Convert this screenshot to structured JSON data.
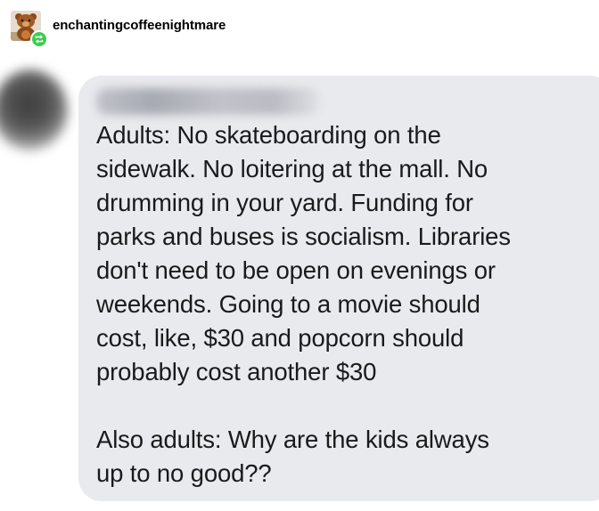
{
  "post": {
    "username": "enchantingcoffeenightmare",
    "avatar_icon": "bear-figure-avatar",
    "badge_icon": "reblog-icon",
    "badge_color": "#3ecc50"
  },
  "message": {
    "sender_name_blurred": true,
    "lines": [
      "Adults: No skateboarding on the",
      "sidewalk. No loitering at the mall. No",
      "drumming in your yard. Funding for",
      "parks and buses is socialism. Libraries",
      "don't need to be open on evenings or",
      "weekends. Going to a movie should",
      "cost, like, $30 and popcorn should",
      "probably cost another $30",
      "",
      "Also adults: Why are the kids always",
      "up to no good??"
    ],
    "bubble_color": "#e9eaee"
  }
}
